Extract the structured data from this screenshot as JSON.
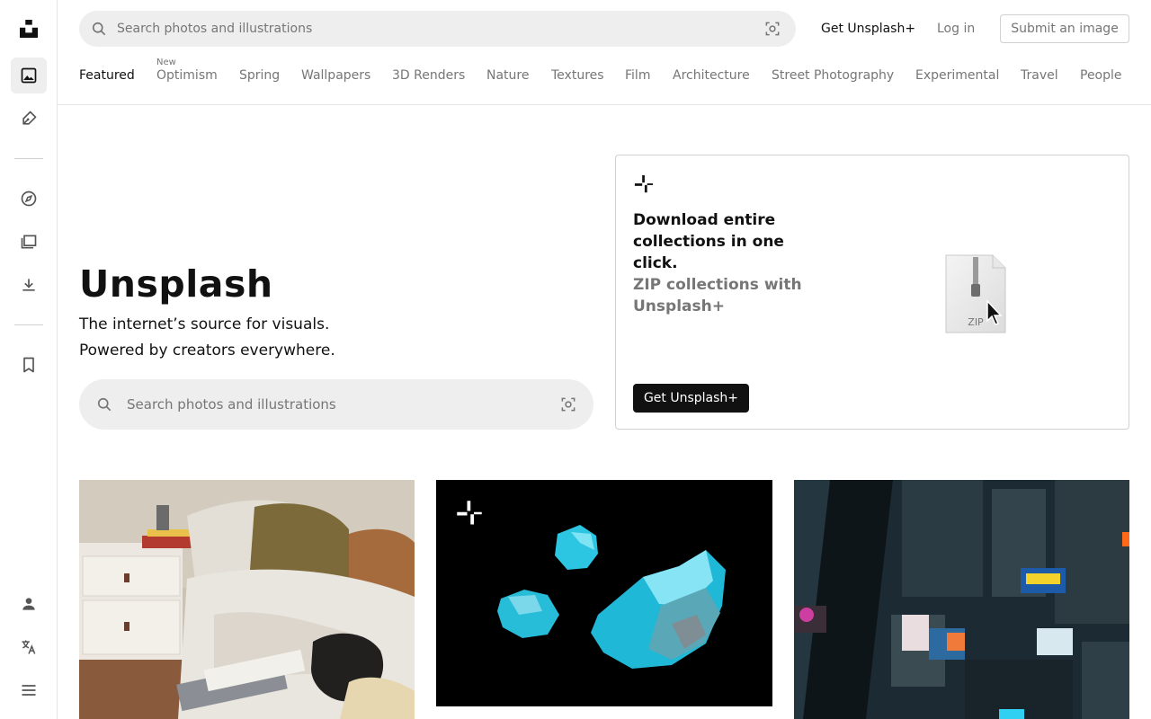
{
  "header": {
    "search_placeholder": "Search photos and illustrations",
    "get_plus_label": "Get Unsplash+",
    "login_label": "Log in",
    "submit_label": "Submit an image"
  },
  "topics": [
    {
      "label": "Featured",
      "active": true
    },
    {
      "label": "Optimism",
      "badge": "New"
    },
    {
      "label": "Spring"
    },
    {
      "label": "Wallpapers"
    },
    {
      "label": "3D Renders"
    },
    {
      "label": "Nature"
    },
    {
      "label": "Textures"
    },
    {
      "label": "Film"
    },
    {
      "label": "Architecture"
    },
    {
      "label": "Street Photography"
    },
    {
      "label": "Experimental"
    },
    {
      "label": "Travel"
    },
    {
      "label": "People"
    }
  ],
  "hero": {
    "title": "Unsplash",
    "subtitle_line1": "The internet’s source for visuals.",
    "subtitle_line2": "Powered by creators everywhere.",
    "search_placeholder": "Search photos and illustrations"
  },
  "promo": {
    "headline": "Download entire collections in one click.",
    "subline": "ZIP collections with Unsplash+",
    "cta_label": "Get Unsplash+",
    "zip_label": "ZIP"
  },
  "colors": {
    "text_primary": "#111111",
    "text_muted": "#767676",
    "surface": "#eeeeee",
    "border": "#d1d1d1",
    "accent_turquoise": "#29c3e0"
  },
  "rail_icons": [
    "unsplash-logo-icon",
    "photos-icon",
    "illustrations-icon",
    "explore-icon",
    "collections-icon",
    "downloads-icon",
    "bookmark-icon",
    "account-icon",
    "language-icon",
    "menu-icon"
  ]
}
